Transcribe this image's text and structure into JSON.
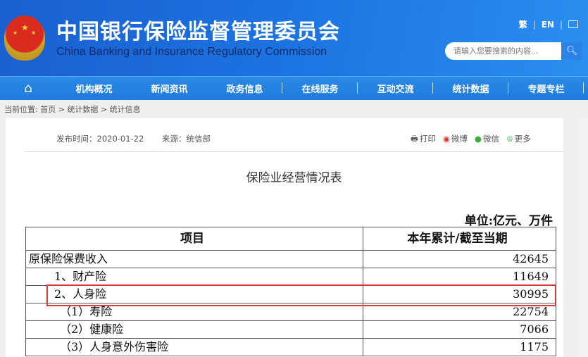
{
  "header": {
    "title_cn": "中国银行保险监督管理委员会",
    "title_en": "China Banking and Insurance Regulatory Commission",
    "links": [
      "繁",
      "EN"
    ],
    "search_placeholder": "请输入您要搜索的内容...",
    "brand_color": "#1c74e0"
  },
  "nav": {
    "items": [
      "机构概况",
      "新闻资讯",
      "政务信息",
      "在线服务",
      "互动交流",
      "统计数据",
      "专题专栏"
    ]
  },
  "breadcrumb": {
    "prefix": "当前位置:",
    "items": [
      "首页",
      ">",
      "统计数据",
      ">",
      "统计信息"
    ]
  },
  "article": {
    "publish": "发布时间：2020-01-22",
    "source": "来源：统信部",
    "share": [
      "打印",
      "微博",
      "微信",
      "更多"
    ],
    "title": "保险业经营情况表",
    "unit": "单位:亿元、万件"
  },
  "table": {
    "headers": [
      "项目",
      "本年累计/截至当期"
    ],
    "rows": [
      {
        "label": "原保险保费收入",
        "value": "42645"
      },
      {
        "label": "1、财产险",
        "value": "11649"
      },
      {
        "label": "2、人身险",
        "value": "30995"
      },
      {
        "label": "（1）寿险",
        "value": "22754"
      },
      {
        "label": "（2）健康险",
        "value": "7066"
      },
      {
        "label": "（3）人身意外伤害险",
        "value": "1175"
      }
    ],
    "highlight_color": "#d63a3a"
  }
}
